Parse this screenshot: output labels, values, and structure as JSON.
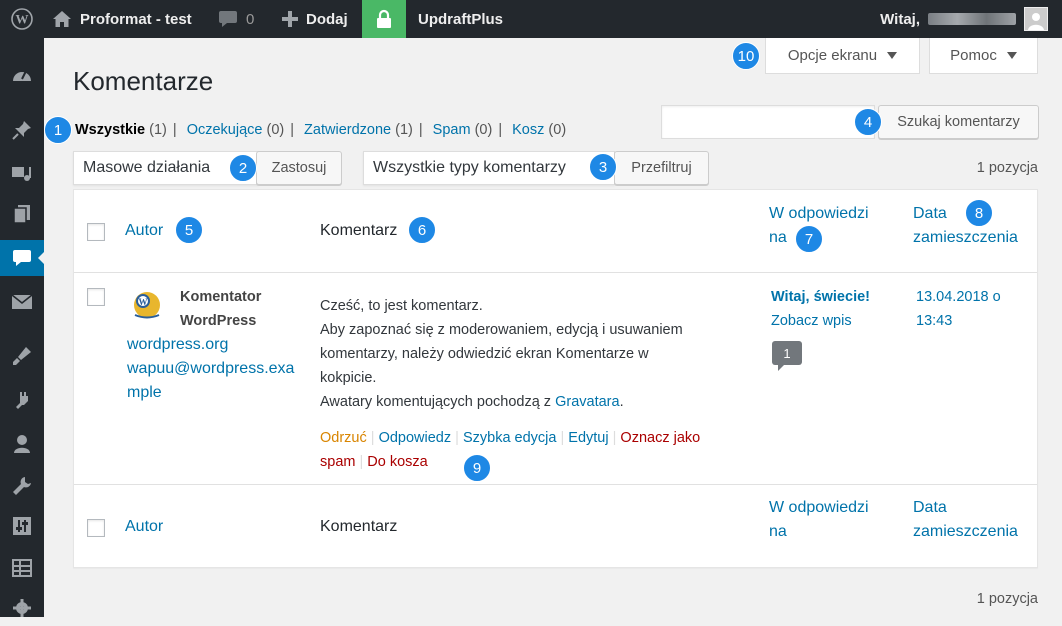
{
  "admin_bar": {
    "site_name": "Proformat - test",
    "comments_count": "0",
    "new_label": "Dodaj",
    "plugin_label": "UpdraftPlus",
    "greeting": "Witaj,"
  },
  "screen_meta": {
    "options_label": "Opcje ekranu",
    "help_label": "Pomoc"
  },
  "page_title": "Komentarze",
  "views": [
    {
      "label": "Wszystkie",
      "count": "(1)"
    },
    {
      "label": "Oczekujące",
      "count": "(0)"
    },
    {
      "label": "Zatwierdzone",
      "count": "(1)"
    },
    {
      "label": "Spam",
      "count": "(0)"
    },
    {
      "label": "Kosz",
      "count": "(0)"
    }
  ],
  "search": {
    "button_label": "Szukaj komentarzy",
    "value": ""
  },
  "bulk": {
    "selected": "Masowe działania",
    "apply_label": "Zastosuj"
  },
  "filter": {
    "selected": "Wszystkie typy komentarzy",
    "button_label": "Przefiltruj"
  },
  "items_count": "1 pozycja",
  "table": {
    "columns": {
      "author": "Autor",
      "comment": "Komentarz",
      "response_1": "W odpowiedzi",
      "response_2": "na",
      "date_1": "Data",
      "date_2": "zamieszczenia"
    },
    "row": {
      "author_name_1": "Komentator",
      "author_name_2": "WordPress",
      "author_url": "wordpress.org",
      "author_email_1": "wapuu@wordpress.exa",
      "author_email_2": "mple",
      "comment_lines": [
        "Cześć, to jest komentarz.",
        "Aby zapoznać się z moderowaniem, edycją i usuwaniem",
        "komentarzy, należy odwiedzić ekran Komentarze w",
        "kokpicie."
      ],
      "comment_last_prefix": "Awatary komentujących pochodzą z ",
      "comment_last_link": "Gravatara",
      "comment_last_suffix": ".",
      "actions": {
        "unapprove": "Odrzuć",
        "reply": "Odpowiedz",
        "quickedit": "Szybka edycja",
        "edit": "Edytuj",
        "spam_1": "Oznacz jako",
        "spam_2": "spam",
        "trash": "Do kosza"
      },
      "post_title": "Witaj, świecie!",
      "view_post": "Zobacz wpis",
      "post_comment_count": "1",
      "date_1": "13.04.2018 o",
      "date_2": "13:43"
    }
  },
  "badges": [
    "1",
    "2",
    "3",
    "4",
    "5",
    "6",
    "7",
    "8",
    "9",
    "10"
  ],
  "colors": {
    "admin_bar": "#23282d",
    "link": "#0073aa",
    "current_menu": "#0073aa",
    "lock_green": "#4ab866",
    "unapprove": "#d98500",
    "delete": "#a00",
    "badge": "#1e88e5"
  }
}
